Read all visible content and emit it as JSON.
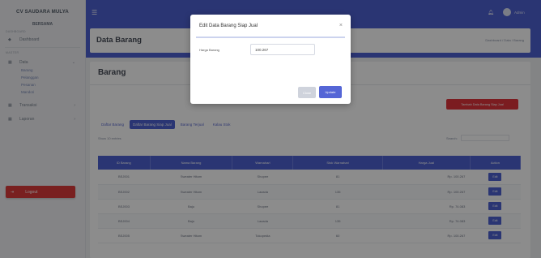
{
  "sidebar": {
    "brand_line1": "CV SAUDARA MULYA",
    "brand_line2": "BERSAMA",
    "section_main": "DASHBOARD",
    "dashboard_label": "Dashboard",
    "section_master": "MASTER",
    "data_label": "Data",
    "data_submenu": [
      "Barang",
      "Pelanggan",
      "Pesanan",
      "Mandori"
    ],
    "transaksi_label": "Transaksi",
    "laporan_label": "Laporan",
    "logout_label": "Logout"
  },
  "topbar": {
    "user_name": "Admin",
    "menu_icon": "hamburger-icon",
    "bell_icon": "bell-icon"
  },
  "header": {
    "title": "Data Barang",
    "breadcrumb": "Dashboard / Data / Barang"
  },
  "card": {
    "title": "Barang",
    "add_button": "Tambah Data Barang Siap Jual",
    "tabs": [
      "Daftar Barang",
      "Daftar Barang Siap Jual",
      "Barang Terjual",
      "Kalau Stok"
    ],
    "show_text": "Show 10 entries",
    "search_label": "Search:"
  },
  "table": {
    "headers": [
      "ID Barang",
      "Nama Barang",
      "Warnahari",
      "Stok Warnahari",
      "Harga Jual",
      "Action"
    ],
    "rows": [
      [
        "BSJ001",
        "Sweater Hitam",
        "Shopee",
        "81",
        "Rp. 100.267",
        "Edit"
      ],
      [
        "BSJ002",
        "Sweater Hitam",
        "Lazada",
        "135",
        "Rp. 100.267",
        "Edit"
      ],
      [
        "BSJ003",
        "Baju",
        "Shopee",
        "81",
        "Rp. 74.083",
        "Edit"
      ],
      [
        "BSJ004",
        "Baju",
        "Lazada",
        "135",
        "Rp. 74.083",
        "Edit"
      ],
      [
        "BSJ005",
        "Sweater Hitam",
        "Tokopedia",
        "60",
        "Rp. 100.267",
        "Edit"
      ]
    ]
  },
  "modal": {
    "title": "Edit Data Barang Siap Jual",
    "field_label": "Harga Barang",
    "field_value": "100.267",
    "close_button": "Close",
    "update_button": "Update"
  },
  "colors": {
    "primary": "#4e62d2",
    "danger": "#dc3b3b",
    "sidebar_bg": "#f0f1f4"
  }
}
